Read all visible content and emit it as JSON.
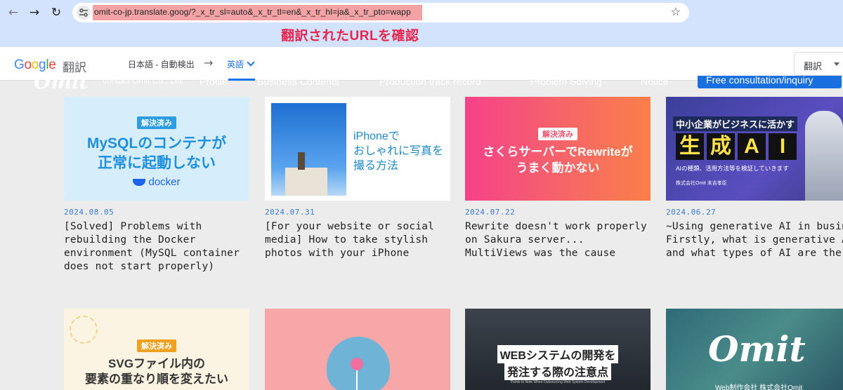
{
  "browser": {
    "url": "omit-co-jp.translate.goog/?_x_tr_sl=auto&_x_tr_tl=en&_x_tr_hl=ja&_x_tr_pto=wapp",
    "highlight_color": "#f3a3a3",
    "annotation": "翻訳されたURLを確認"
  },
  "translate_bar": {
    "logo": [
      "G",
      "o",
      "o",
      "g",
      "l",
      "e"
    ],
    "logo_colors": [
      "#4285f4",
      "#ea4335",
      "#fbbc05",
      "#4285f4",
      "#34a853",
      "#ea4335"
    ],
    "product": "翻訳",
    "source_lang": "日本語 - 自動検出",
    "target_lang": "英語",
    "translate_button": "翻訳"
  },
  "site_nav": {
    "logo": "Omit",
    "company": "contact Omit Co., Ltd.",
    "items": [
      "Profile",
      "Business Contents",
      "Production track record",
      "Problem Solving",
      "Notice"
    ],
    "consult": "Free consultation/inquiry"
  },
  "cards": [
    {
      "date": "2024.08.05",
      "title": "[Solved] Problems with rebuilding the Docker environment (MySQL container does not start properly)",
      "thumb": {
        "badge": "解決済み",
        "line1": "MySQLのコンテナが",
        "line2": "正常に起動しない",
        "brand": "docker"
      }
    },
    {
      "date": "2024.07.31",
      "title": "[For your website or social media] How to take stylish photos with your iPhone",
      "thumb": {
        "line1": "iPhoneで",
        "line2": "おしゃれに写真を",
        "line3": "撮る方法"
      }
    },
    {
      "date": "2024.07.22",
      "title": "Rewrite doesn't work properly on Sakura server... MultiViews was the cause",
      "thumb": {
        "badge": "解決済み",
        "line1": "さくらサーバーでRewriteが",
        "line2": "うまく動かない"
      }
    },
    {
      "date": "2024.06.27",
      "title": "~Using generative AI in business~ Firstly, what is generative AI and what types of AI are there?",
      "thumb": {
        "line1": "中小企業がビジネスに活かす",
        "big": [
          "生",
          "成",
          "A",
          "I"
        ],
        "sub": "AIの種類、活用方法等を検証していきます",
        "credit": "株式会社Omit 末吉孝臣"
      }
    },
    {
      "thumb": {
        "badge": "解決済み",
        "line1": "SVGファイル内の",
        "line2": "要素の重なり順を変えたい"
      }
    },
    {
      "thumb": {}
    },
    {
      "thumb": {
        "line1": "WEBシステムの開発を",
        "line2": "発注する際の注意点",
        "small": "Points to Note When Outsourcing Web System Development"
      }
    },
    {
      "thumb": {
        "logo": "Omit",
        "caption": "Web制作会社 株式会社Omit"
      }
    }
  ]
}
